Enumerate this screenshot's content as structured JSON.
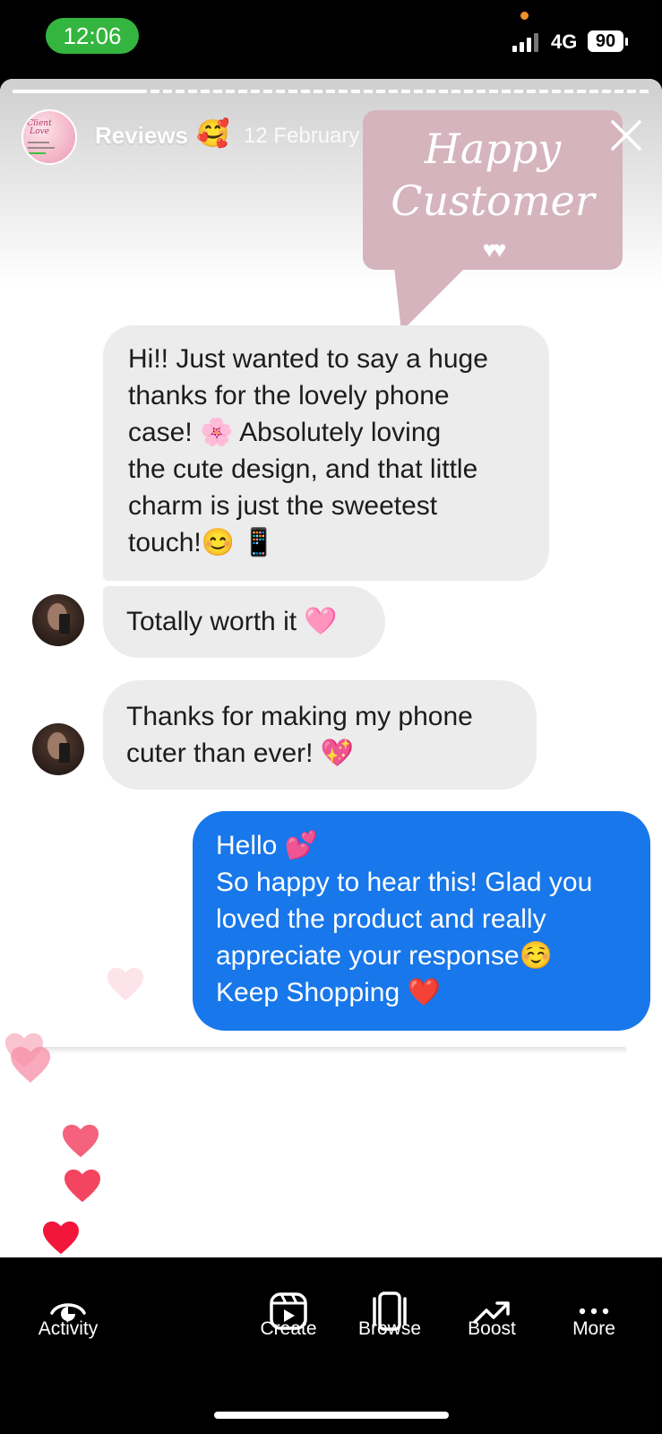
{
  "status_bar": {
    "time": "12:06",
    "network": "4G",
    "battery": "90"
  },
  "story": {
    "account_name": "Reviews",
    "account_emoji": "🥰",
    "date": "12 February",
    "avatar_brand": "Client Love",
    "sticker": {
      "line1": "Happy",
      "line2": "Customer",
      "hearts": "♥♥"
    },
    "messages": [
      {
        "lines": [
          "Hi!! Just wanted to say a huge",
          "thanks for the lovely phone",
          "case! 🌸 Absolutely loving",
          "the cute design, and that little",
          "charm is just the sweetest",
          "touch!😊 📱"
        ]
      },
      {
        "lines": [
          "Totally worth it 🩷"
        ]
      },
      {
        "lines": [
          "Thanks for making my phone",
          "cuter than ever! 💖"
        ]
      },
      {
        "lines": [
          "Hello 💕",
          "So happy to hear this! Glad you",
          "loved the product and really",
          "appreciate your response☺️",
          "Keep Shopping ❤️"
        ]
      }
    ]
  },
  "toolbar": {
    "items": [
      {
        "label": "Activity",
        "icon": "activity-eye-icon"
      },
      {
        "label": "Create",
        "icon": "create-reel-icon"
      },
      {
        "label": "Browse",
        "icon": "browse-stack-icon"
      },
      {
        "label": "Boost",
        "icon": "boost-trend-icon"
      },
      {
        "label": "More",
        "icon": "more-dots-icon"
      }
    ]
  },
  "colors": {
    "reply_bubble": "#1877ea",
    "incoming_bubble": "#ececec",
    "sticker": "#d5b4bd",
    "time_pill": "#34b53f"
  }
}
